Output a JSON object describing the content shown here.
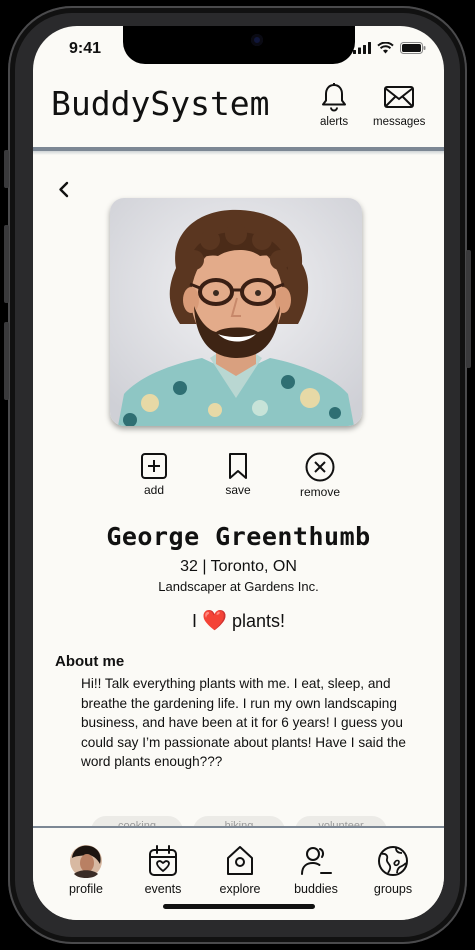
{
  "status_bar": {
    "time": "9:41"
  },
  "header": {
    "app_title": "BuddySystem",
    "alerts_label": "alerts",
    "messages_label": "messages"
  },
  "profile": {
    "name": "George Greenthumb",
    "age_location": "32 | Toronto, ON",
    "job": "Landscaper at Gardens Inc.",
    "tagline_prefix": "I",
    "tagline_emoji": "❤️",
    "tagline_suffix": "plants!",
    "actions": {
      "add": "add",
      "save": "save",
      "remove": "remove"
    },
    "about_title": "About me",
    "about_text": "Hi!! Talk everything plants with me. I eat, sleep, and breathe the gardening life. I run my own landscaping business, and have been at it for 6 years! I guess you could say I’m passionate about plants! Have I said the word plants enough???",
    "interest_chips": [
      "cooking",
      "hiking",
      "volunteer"
    ]
  },
  "nav": {
    "items": [
      {
        "label": "profile",
        "icon": "avatar"
      },
      {
        "label": "events",
        "icon": "calendar-heart-icon"
      },
      {
        "label": "explore",
        "icon": "home-icon"
      },
      {
        "label": "buddies",
        "icon": "user-minus-icon"
      },
      {
        "label": "groups",
        "icon": "globe-icon"
      }
    ]
  },
  "colors": {
    "background": "#fbfaf6",
    "divider": "#7c8794",
    "heart": "#e0212e"
  }
}
